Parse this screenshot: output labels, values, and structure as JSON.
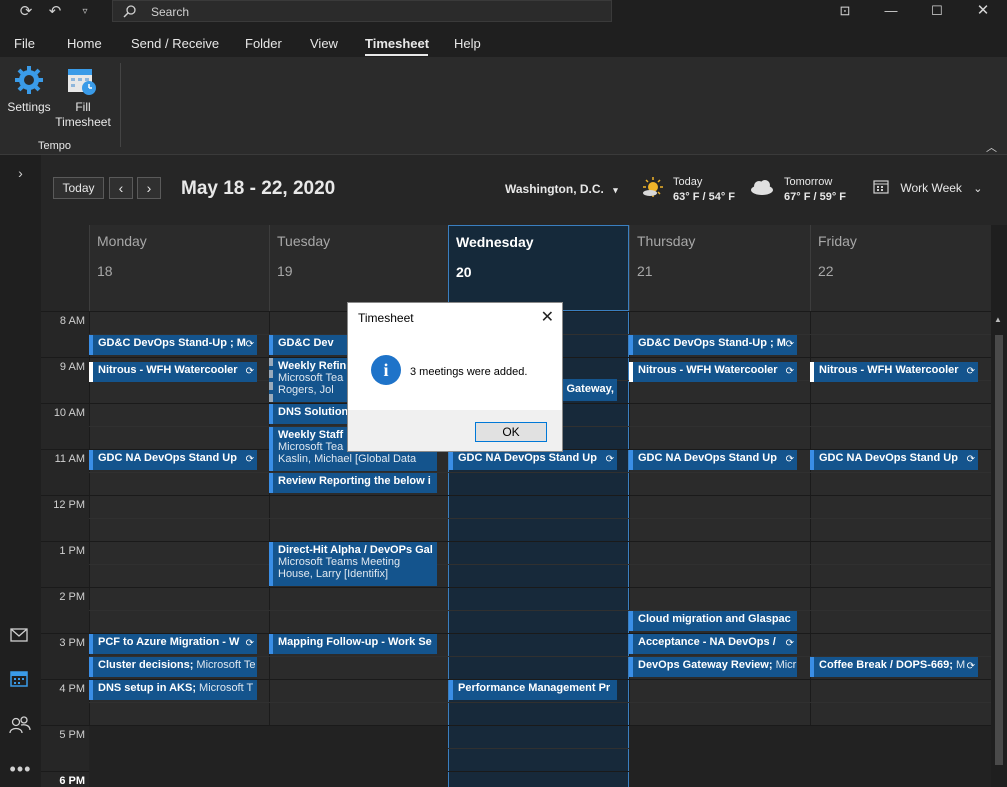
{
  "titlebar": {
    "search_placeholder": "Search"
  },
  "menu": {
    "items": [
      "File",
      "Home",
      "Send / Receive",
      "Folder",
      "View",
      "Timesheet",
      "Help"
    ],
    "active": "Timesheet"
  },
  "ribbon": {
    "settings_label": "Settings",
    "fill_label_1": "Fill",
    "fill_label_2": "Timesheet",
    "group_label": "Tempo"
  },
  "calendar": {
    "today_button": "Today",
    "date_range": "May 18 - 22, 2020",
    "location": "Washington,  D.C.",
    "weather_today_label": "Today",
    "weather_today_temp": "63° F / 54° F",
    "weather_tomorrow_label": "Tomorrow",
    "weather_tomorrow_temp": "67° F / 59° F",
    "view_label": "Work Week",
    "days": [
      {
        "name": "Monday",
        "num": "18"
      },
      {
        "name": "Tuesday",
        "num": "19"
      },
      {
        "name": "Wednesday",
        "num": "20"
      },
      {
        "name": "Thursday",
        "num": "21"
      },
      {
        "name": "Friday",
        "num": "22"
      }
    ],
    "hours": [
      "8 AM",
      "9 AM",
      "10 AM",
      "11 AM",
      "12 PM",
      "1 PM",
      "2 PM",
      "3 PM",
      "4 PM",
      "5 PM",
      "6 PM"
    ]
  },
  "events": {
    "mon_1": "GD&C DevOps Stand-Up ; M",
    "mon_2": "Nitrous - WFH Watercooler",
    "mon_3": "GDC NA DevOps Stand Up",
    "mon_4": "PCF to Azure Migration - W",
    "mon_5_bold": "Cluster decisions;",
    "mon_5_sub": " Microsoft Te",
    "mon_6_bold": "DNS setup in AKS;",
    "mon_6_sub": " Microsoft T",
    "tue_1": "GD&C Dev",
    "tue_2_l1": "Weekly Refin",
    "tue_2_l2": "Microsoft Tea",
    "tue_2_l3": "Rogers, Jol",
    "tue_3": "DNS Solution",
    "tue_4_l1": "Weekly Staff",
    "tue_4_l2": "Microsoft Tea",
    "tue_4_l3": "Kaslin, Michael [Global Data",
    "tue_5": "Review Reporting the below i",
    "tue_6_l1": "Direct-Hit Alpha / DevOPs Gal",
    "tue_6_l2": "Microsoft Teams Meeting",
    "tue_6_l3": "House, Larry [Identifix]",
    "tue_7": "Mapping Follow-up - Work Se",
    "wed_1": "Gateway,",
    "wed_2": "GDC NA DevOps Stand Up",
    "wed_3": "Performance Management Pr",
    "thu_1": "GD&C DevOps Stand-Up ; M",
    "thu_2": "Nitrous - WFH Watercooler",
    "thu_3": "GDC NA DevOps Stand Up",
    "thu_4": "Cloud migration and Glaspac",
    "thu_5": "Acceptance - NA DevOps / ",
    "thu_6_bold": "DevOps Gateway Review;",
    "thu_6_sub": " Micr",
    "fri_1": "Nitrous - WFH Watercooler",
    "fri_2": "GDC NA DevOps Stand Up",
    "fri_3_bold": "Coffee Break / DOPS-669;",
    "fri_3_sub": " M"
  },
  "dialog": {
    "title": "Timesheet",
    "message": "3 meetings were added.",
    "ok": "OK"
  },
  "colors": {
    "event_bg": "#14548d",
    "event_accent": "#3a8ee6",
    "today_bg": "#15293a",
    "dialog_info": "#1e73c9"
  }
}
